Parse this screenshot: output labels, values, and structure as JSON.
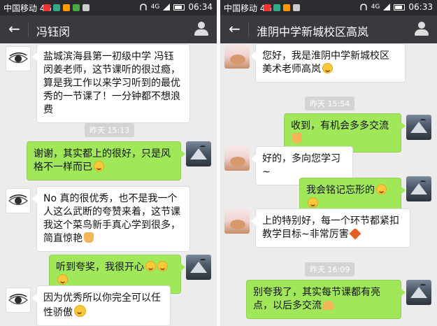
{
  "left": {
    "status": {
      "carrier": "中国移动 4G",
      "net": "4G",
      "time": "06:34"
    },
    "header": {
      "title": "冯钰闵"
    },
    "messages": [
      {
        "text": "盐城滨海县第一初级中学 冯钰闵姜老师，这节课听的很过瘾，算是我工作以来学习听到的最优秀的一节课了！一分钟都不想浪费"
      },
      {
        "time": "昨天 15:13"
      },
      {
        "text": "谢谢，其实都上的很好，只是风格不一样而已"
      },
      {
        "text": "No 真的很优秀，也不是我一个人这么武断的夸赞来着，这节课我这个菜鸟新手真心学到很多，简直惊艳"
      },
      {
        "text": "听到夸奖，我很开心"
      },
      {
        "text": "因为优秀所以你完全可以任性骄傲"
      }
    ]
  },
  "right": {
    "status": {
      "carrier": "中国移动 4G",
      "net": "4G",
      "time": "06:33"
    },
    "header": {
      "title": "淮阴中学新城校区高岚"
    },
    "messages": [
      {
        "text": "您好，我是淮阴中学新城校区美术老师高岚"
      },
      {
        "time": "昨天 15:54"
      },
      {
        "text": "收到，有机会多多交流"
      },
      {
        "text": "好的，多向您学习~"
      },
      {
        "text": "我会铭记忘形的"
      },
      {
        "text": "上的特别好，每一个环节都紧扣教学目标~非常厉害"
      },
      {
        "time": "昨天 16:09"
      },
      {
        "text": "别夸我了，其实每节课都有亮点，以后多交流"
      }
    ]
  }
}
